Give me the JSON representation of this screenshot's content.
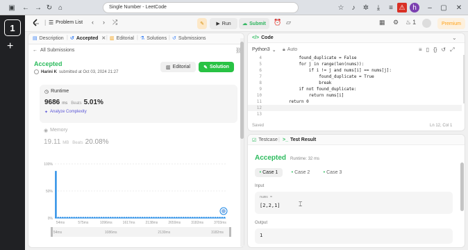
{
  "browser": {
    "url": "Single Number - LeetCode",
    "tab_number": "1",
    "profile_initial": "h"
  },
  "lc_top": {
    "problem_list": "Problem List",
    "run": "Run",
    "submit": "Submit",
    "fire_count": "1",
    "premium": "Premium"
  },
  "left_tabs": {
    "description": "Description",
    "accepted": "Accepted",
    "editorial": "Editorial",
    "solutions": "Solutions",
    "submissions": "Submissions"
  },
  "submission": {
    "back_label": "All Submissions",
    "status": "Accepted",
    "user": "Harini K",
    "submitted_at": "submitted at Oct 03, 2024 21:27",
    "editorial_btn": "Editorial",
    "solution_btn": "Solution"
  },
  "runtime": {
    "label": "Runtime",
    "value": "9686",
    "unit": "ms",
    "beats_label": "Beats",
    "beats_value": "5.01%",
    "analyze": "Analyze Complexity"
  },
  "memory": {
    "label": "Memory",
    "value": "19.11",
    "unit": "MB",
    "beats_label": "Beats",
    "beats_value": "20.08%"
  },
  "chart_data": {
    "type": "bar",
    "y_ticks": [
      "100%",
      "50%",
      "0%"
    ],
    "x_ticks": [
      "54ms",
      "575ms",
      "1096ms",
      "1617ms",
      "2138ms",
      "2659ms",
      "3182ms",
      "3703ms"
    ],
    "bottom_ticks": [
      "54ms",
      "1086ms",
      "2130ms",
      "3182ms"
    ],
    "ylim": [
      0,
      100
    ],
    "values": [
      87,
      2,
      2,
      2,
      2,
      2,
      2,
      2,
      2,
      2,
      2,
      2,
      2,
      2,
      2,
      2,
      2,
      2,
      2,
      2,
      2,
      2,
      2,
      2,
      2,
      2,
      2,
      2,
      2,
      2,
      2,
      2,
      2,
      2,
      2,
      2,
      2,
      2,
      2,
      2,
      2,
      2,
      2,
      2,
      2,
      2,
      2,
      2,
      2,
      2,
      2,
      2,
      2,
      2,
      2,
      2,
      2,
      2,
      2,
      2,
      2,
      2,
      2,
      2,
      2,
      2,
      2,
      2,
      2,
      2,
      2,
      2,
      2,
      2,
      2
    ],
    "bar_color": "#1e88e5"
  },
  "code": {
    "title": "Code",
    "language": "Python3",
    "auto": "Auto",
    "lines": [
      {
        "n": "4",
        "t": "            found_duplicate = False"
      },
      {
        "n": "5",
        "t": "            for j in range(len(nums)):"
      },
      {
        "n": "6",
        "t": "                if i != j and nums[i] == nums[j]:"
      },
      {
        "n": "7",
        "t": "                    found_duplicate = True"
      },
      {
        "n": "8",
        "t": "                    break"
      },
      {
        "n": "9",
        "t": "            if not found_duplicate:"
      },
      {
        "n": "10",
        "t": "                return nums[i]"
      },
      {
        "n": "11",
        "t": "        return 0"
      },
      {
        "n": "12",
        "t": ""
      },
      {
        "n": "13",
        "t": ""
      }
    ],
    "saved": "Saved",
    "cursor_pos": "Ln 12, Col 1"
  },
  "test": {
    "testcase_tab": "Testcase",
    "result_tab": "Test Result",
    "status": "Accepted",
    "runtime": "Runtime: 32 ms",
    "cases": [
      "Case 1",
      "Case 2",
      "Case 3"
    ],
    "input_label": "Input",
    "param_name": "nums =",
    "param_value": "[2,2,1]",
    "output_label": "Output",
    "output_value": "1"
  },
  "colors": {
    "accepted_green": "#2cbb5d",
    "solution_green": "#28c244",
    "submit_green": "#2db55d",
    "run_bg": "#e7e7e7",
    "premium_orange": "#ffa116",
    "chart_blue": "#1e88e5"
  }
}
